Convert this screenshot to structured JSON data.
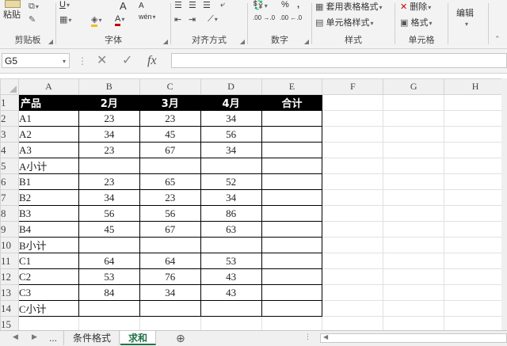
{
  "ribbon": {
    "clipboard": {
      "label": "剪贴板",
      "paste": "粘贴"
    },
    "font": {
      "label": "字体",
      "grow": "A",
      "shrink": "A",
      "font_color": "A",
      "wen": "wén"
    },
    "alignment": {
      "label": "对齐方式"
    },
    "number": {
      "label": "数字",
      "percent": "%",
      "comma": ",",
      "dec_inc": ".00 →.0",
      "dec_dec": ".00 ←.0"
    },
    "styles": {
      "label": "样式",
      "format_as_table": "套用表格格式",
      "cell_styles": "单元格样式"
    },
    "cells": {
      "label": "单元格",
      "delete": "删除",
      "format": "格式"
    },
    "editing": {
      "label": "编辑"
    }
  },
  "formula_bar": {
    "name_box": "G5",
    "fx": "fx",
    "formula": ""
  },
  "columns": [
    "A",
    "B",
    "C",
    "D",
    "E",
    "F",
    "G",
    "H"
  ],
  "rows": [
    {
      "n": "1",
      "cells": [
        "产品",
        "2月",
        "3月",
        "4月",
        "合计"
      ]
    },
    {
      "n": "2",
      "cells": [
        "A1",
        "23",
        "23",
        "34",
        ""
      ]
    },
    {
      "n": "3",
      "cells": [
        "A2",
        "34",
        "45",
        "56",
        ""
      ]
    },
    {
      "n": "4",
      "cells": [
        "A3",
        "23",
        "67",
        "34",
        ""
      ]
    },
    {
      "n": "5",
      "cells": [
        "A小计",
        "",
        "",
        "",
        ""
      ]
    },
    {
      "n": "6",
      "cells": [
        "B1",
        "23",
        "65",
        "52",
        ""
      ]
    },
    {
      "n": "7",
      "cells": [
        "B2",
        "34",
        "23",
        "34",
        ""
      ]
    },
    {
      "n": "8",
      "cells": [
        "B3",
        "56",
        "56",
        "86",
        ""
      ]
    },
    {
      "n": "9",
      "cells": [
        "B4",
        "45",
        "67",
        "63",
        ""
      ]
    },
    {
      "n": "10",
      "cells": [
        "B小计",
        "",
        "",
        "",
        ""
      ]
    },
    {
      "n": "11",
      "cells": [
        "C1",
        "64",
        "64",
        "53",
        ""
      ]
    },
    {
      "n": "12",
      "cells": [
        "C2",
        "53",
        "76",
        "43",
        ""
      ]
    },
    {
      "n": "13",
      "cells": [
        "C3",
        "84",
        "34",
        "43",
        ""
      ]
    },
    {
      "n": "14",
      "cells": [
        "C小计",
        "",
        "",
        "",
        ""
      ]
    },
    {
      "n": "15",
      "cells": [
        "",
        "",
        "",
        "",
        ""
      ]
    }
  ],
  "sheet_tabs": {
    "more": "...",
    "tab1": "条件格式",
    "tab2": "求和",
    "add": "⊕"
  },
  "colors": {
    "accent": "#217346",
    "header_fill": "#000000",
    "header_text": "#ffffff"
  }
}
